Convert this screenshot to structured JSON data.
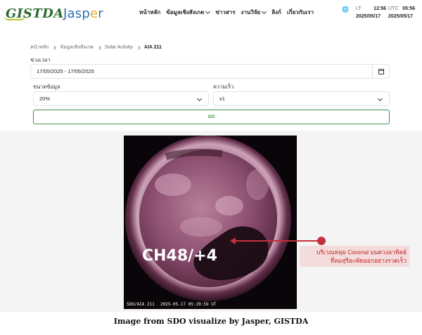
{
  "header": {
    "logo_left": "GISTDA",
    "logo_right_main": "Jasp",
    "logo_right_accent": "e",
    "logo_right_tail": "r",
    "nav": [
      {
        "label": "หน้าหลัก",
        "dropdown": false
      },
      {
        "label": "ข้อมูลเชิงสังเกต",
        "dropdown": true
      },
      {
        "label": "ข่าวสาร",
        "dropdown": false
      },
      {
        "label": "งานวิจัย",
        "dropdown": true
      },
      {
        "label": "ลิงก์",
        "dropdown": false
      },
      {
        "label": "เกี่ยวกับเรา",
        "dropdown": false
      }
    ],
    "lang_icon": "🌐",
    "clock_lt": {
      "label": "LT",
      "time": "12:56",
      "date": "2025/05/17"
    },
    "clock_utc": {
      "label": "UTC",
      "time": "05:56",
      "date": "2025/05/17"
    }
  },
  "breadcrumb": {
    "items": [
      "หน้าหลัก",
      "ข้อมูลเชิงสังเกต",
      "Solar Activity"
    ],
    "current": "AIA 211"
  },
  "form": {
    "period_label": "ช่วงเวลา",
    "period_value": "17/05/2025 - 17/05/2025",
    "size_label": "ขนาดข้อมูล",
    "size_value": "20%",
    "speed_label": "ความเร็ว",
    "speed_value": "x1",
    "go_label": "GO"
  },
  "image": {
    "overlay_label": "CH48/+4",
    "footer_left": "SDO/AIA  211",
    "footer_right": "2025-05-17  05:29:59  UT",
    "annotation_line1": "บริเวณหลุม Coronal บนดวงอาทิตย์",
    "annotation_line2": "ที่ลมสุริยะพัดออกอย่างรวดเร็ว",
    "caption": "Image from SDO visualize by Jasper, GISTDA",
    "colors": {
      "sun_glow": "#e7b6cf",
      "sun_mid": "#8a4a6d",
      "sun_dark": "#2a1020",
      "annotation": "#c4323a"
    }
  }
}
